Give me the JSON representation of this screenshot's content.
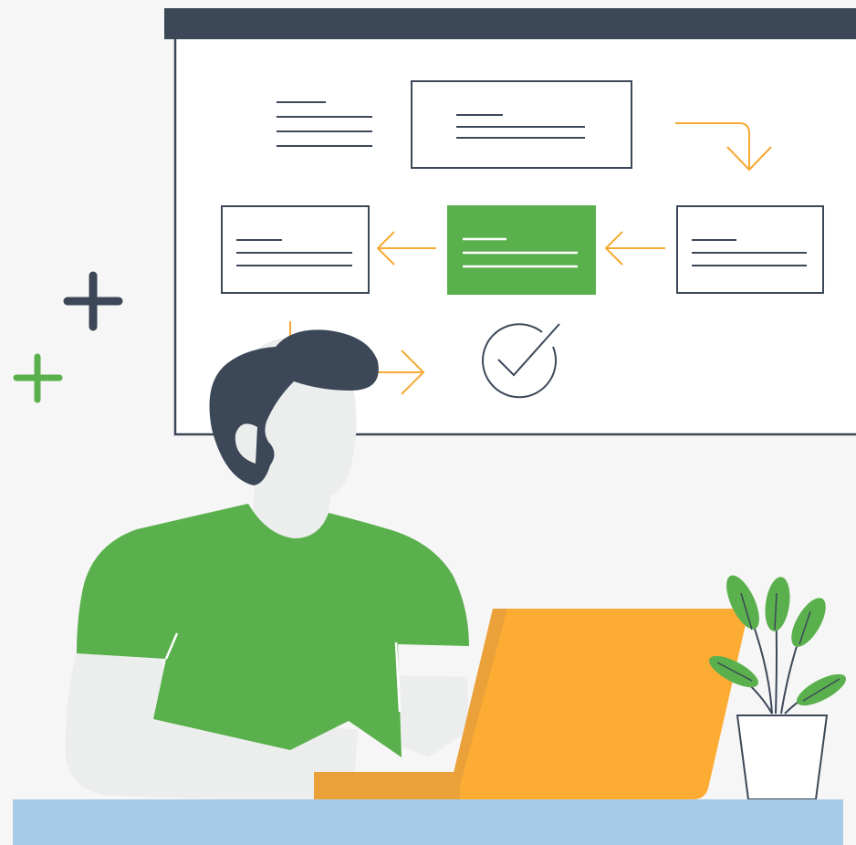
{
  "colors": {
    "background": "#f6f6f6",
    "dark": "#3c4858",
    "white": "#ffffff",
    "green": "#5ab04c",
    "orange": "#f6a934",
    "laptop": "#fdac33",
    "laptop_shade": "#eba13a",
    "skin": "#eceeed",
    "desk": "#a7cbe6"
  },
  "icons": [
    "plus-icon",
    "arrow-right-icon",
    "arrow-left-icon",
    "arrow-down-icon",
    "checkmark-circle-icon"
  ]
}
